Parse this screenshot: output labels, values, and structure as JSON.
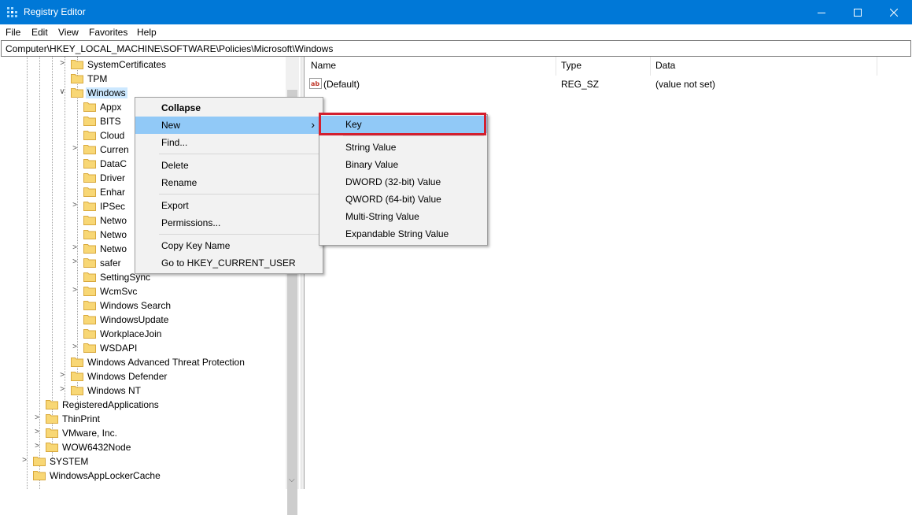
{
  "window": {
    "title": "Registry Editor"
  },
  "menubar": [
    "File",
    "Edit",
    "View",
    "Favorites",
    "Help"
  ],
  "address": "Computer\\HKEY_LOCAL_MACHINE\\SOFTWARE\\Policies\\Microsoft\\Windows",
  "tree": [
    {
      "label": "SystemCertificates",
      "depth": 3,
      "expand": "collapsed"
    },
    {
      "label": "TPM",
      "depth": 3,
      "expand": "none"
    },
    {
      "label": "Windows",
      "depth": 3,
      "expand": "expanded",
      "selected": true
    },
    {
      "label": "Appx",
      "depth": 4,
      "expand": "none"
    },
    {
      "label": "BITS",
      "depth": 4,
      "expand": "none"
    },
    {
      "label": "Cloud",
      "depth": 4,
      "expand": "none"
    },
    {
      "label": "Curren",
      "depth": 4,
      "expand": "collapsed"
    },
    {
      "label": "DataC",
      "depth": 4,
      "expand": "none"
    },
    {
      "label": "Driver",
      "depth": 4,
      "expand": "none"
    },
    {
      "label": "Enhar",
      "depth": 4,
      "expand": "none"
    },
    {
      "label": "IPSec",
      "depth": 4,
      "expand": "collapsed"
    },
    {
      "label": "Netwo",
      "depth": 4,
      "expand": "none"
    },
    {
      "label": "Netwo",
      "depth": 4,
      "expand": "none"
    },
    {
      "label": "Netwo",
      "depth": 4,
      "expand": "collapsed"
    },
    {
      "label": "safer",
      "depth": 4,
      "expand": "collapsed"
    },
    {
      "label": "SettingSync",
      "depth": 4,
      "expand": "none"
    },
    {
      "label": "WcmSvc",
      "depth": 4,
      "expand": "collapsed"
    },
    {
      "label": "Windows Search",
      "depth": 4,
      "expand": "none"
    },
    {
      "label": "WindowsUpdate",
      "depth": 4,
      "expand": "none"
    },
    {
      "label": "WorkplaceJoin",
      "depth": 4,
      "expand": "none"
    },
    {
      "label": "WSDAPI",
      "depth": 4,
      "expand": "collapsed"
    },
    {
      "label": "Windows Advanced Threat Protection",
      "depth": 3,
      "expand": "none"
    },
    {
      "label": "Windows Defender",
      "depth": 3,
      "expand": "collapsed"
    },
    {
      "label": "Windows NT",
      "depth": 3,
      "expand": "collapsed"
    },
    {
      "label": "RegisteredApplications",
      "depth": 1,
      "expand": "none"
    },
    {
      "label": "ThinPrint",
      "depth": 1,
      "expand": "collapsed"
    },
    {
      "label": "VMware, Inc.",
      "depth": 1,
      "expand": "collapsed"
    },
    {
      "label": "WOW6432Node",
      "depth": 1,
      "expand": "collapsed"
    },
    {
      "label": "SYSTEM",
      "depth": 0,
      "expand": "collapsed"
    },
    {
      "label": "WindowsAppLockerCache",
      "depth": 0,
      "expand": "none"
    }
  ],
  "list": {
    "columns": [
      "Name",
      "Type",
      "Data"
    ],
    "rows": [
      {
        "name": "(Default)",
        "type": "REG_SZ",
        "data": "(value not set)"
      }
    ]
  },
  "context_menu": {
    "items": [
      {
        "label": "Collapse",
        "bold": true
      },
      {
        "label": "New",
        "submenu": true,
        "highlighted": true
      },
      {
        "label": "Find..."
      },
      {
        "separator": true
      },
      {
        "label": "Delete"
      },
      {
        "label": "Rename"
      },
      {
        "separator": true
      },
      {
        "label": "Export"
      },
      {
        "label": "Permissions..."
      },
      {
        "separator": true
      },
      {
        "label": "Copy Key Name"
      },
      {
        "label": "Go to HKEY_CURRENT_USER"
      }
    ]
  },
  "submenu": {
    "items": [
      {
        "label": "Key",
        "highlighted": true
      },
      {
        "separator": true
      },
      {
        "label": "String Value"
      },
      {
        "label": "Binary Value"
      },
      {
        "label": "DWORD (32-bit) Value"
      },
      {
        "label": "QWORD (64-bit) Value"
      },
      {
        "label": "Multi-String Value"
      },
      {
        "label": "Expandable String Value"
      }
    ]
  },
  "colors": {
    "titlebar": "#0078d7",
    "highlight": "#91c9f7",
    "selection": "#cce8ff",
    "callout": "#d3202f",
    "folder": "#f8d775"
  },
  "icons": {
    "app": "registry-editor-icon",
    "folder": "folder-icon",
    "string_value": "reg-sz-ab-icon"
  }
}
